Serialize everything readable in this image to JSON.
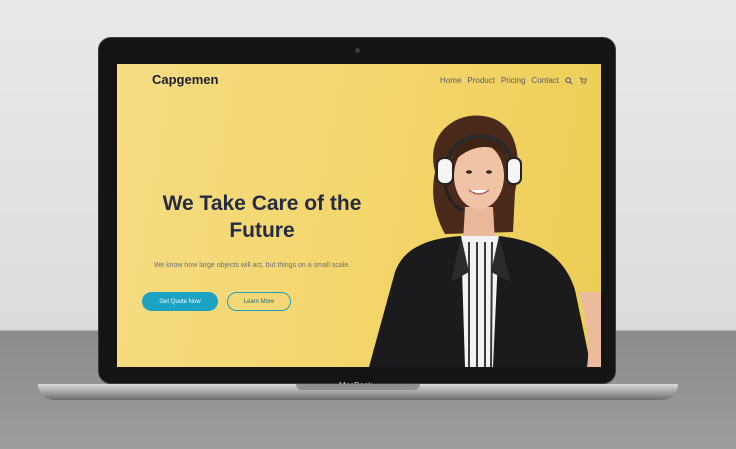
{
  "site": {
    "logo": "Capgemen",
    "nav": [
      "Home",
      "Product",
      "Pricing",
      "Contact"
    ],
    "icons": [
      "search-icon",
      "cart-icon"
    ]
  },
  "hero": {
    "title_line1": "We Take Care of the",
    "title_line2": "Future",
    "subtitle": "We know how large objects will act, but things on a small scale.",
    "primary_button": "Get Quote Now",
    "secondary_button": "Learn More"
  },
  "device": {
    "brand": "MacBook"
  },
  "colors": {
    "background": "#f3d56a",
    "accent": "#1ca2c2",
    "heading": "#252b42"
  }
}
